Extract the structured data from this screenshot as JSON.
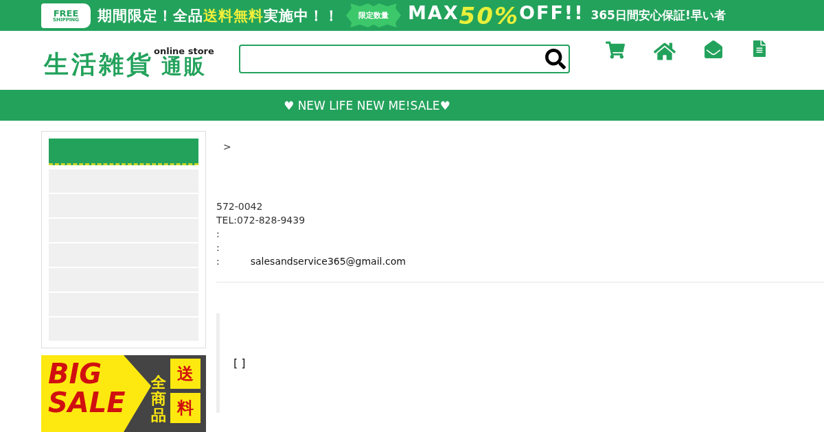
{
  "promo_banner": {
    "badge_lines": [
      "FREE",
      "SHIPPING"
    ],
    "segments": [
      {
        "text": "期間限定！全品",
        "highlight": false
      },
      {
        "text": "送料無料",
        "highlight": true
      },
      {
        "text": "実施中！！",
        "highlight": false
      }
    ],
    "burst": "限定数量",
    "offer": [
      {
        "text": "MAX",
        "highlight": false
      },
      {
        "text": "50%",
        "highlight": true
      },
      {
        "text": "OFF!!",
        "highlight": false
      }
    ],
    "tail": "365日間安心保証!早い者"
  },
  "header": {
    "logo": {
      "main": "生活雑貨",
      "tagline": "online store",
      "sub": "通販"
    }
  },
  "nav_bar": {
    "text": "♥ NEW LIFE NEW ME!SALE♥"
  },
  "sale_banner": {
    "headline": [
      "BIG",
      "SALE"
    ],
    "vertical": "全商品",
    "tiles": [
      "送",
      "料"
    ]
  },
  "content": {
    "breadcrumb": ">",
    "lines": [
      {
        "label": "572-0042"
      },
      {
        "label": "TEL:072-828-9439"
      },
      {
        "label": ":"
      },
      {
        "label": ":"
      },
      {
        "label": ":",
        "link": "salesandservice365@gmail.com"
      }
    ],
    "quote": "[ ]"
  }
}
